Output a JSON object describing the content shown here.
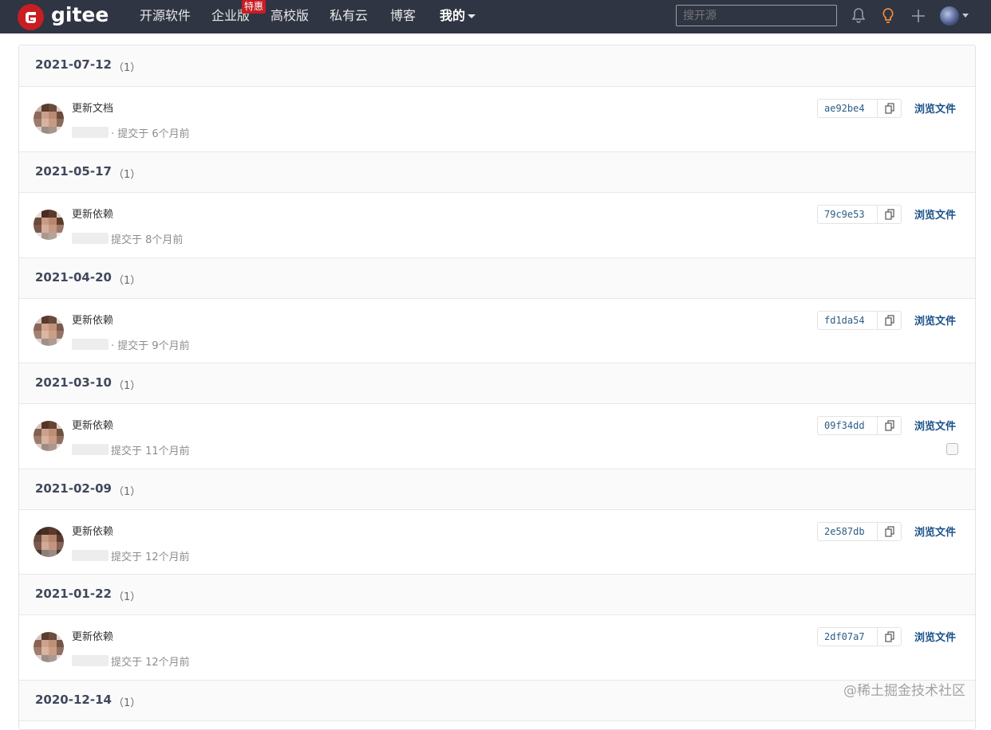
{
  "header": {
    "brand": "gitee",
    "nav": [
      "开源软件",
      "企业版",
      "高校版",
      "私有云",
      "博客",
      "我的"
    ],
    "badge": "特惠",
    "search_placeholder": "搜开源"
  },
  "groups": [
    {
      "date": "2021-07-12",
      "count": "（1）",
      "message": "更新文档",
      "meta": "· 提交于 6个月前",
      "sha": "ae92be4",
      "browse": "浏览文件"
    },
    {
      "date": "2021-05-17",
      "count": "（1）",
      "message": "更新依赖",
      "meta": "提交于 8个月前",
      "sha": "79c9e53",
      "browse": "浏览文件"
    },
    {
      "date": "2021-04-20",
      "count": "（1）",
      "message": "更新依赖",
      "meta": "· 提交于 9个月前",
      "sha": "fd1da54",
      "browse": "浏览文件"
    },
    {
      "date": "2021-03-10",
      "count": "（1）",
      "message": "更新依赖",
      "meta": "提交于 11个月前",
      "sha": "09f34dd",
      "browse": "浏览文件"
    },
    {
      "date": "2021-02-09",
      "count": "（1）",
      "message": "更新依赖",
      "meta": "提交于 12个月前",
      "sha": "2e587db",
      "browse": "浏览文件"
    },
    {
      "date": "2021-01-22",
      "count": "（1）",
      "message": "更新依赖",
      "meta": "提交于 12个月前",
      "sha": "2df07a7",
      "browse": "浏览文件"
    },
    {
      "date": "2020-12-14",
      "count": "（1）"
    }
  ],
  "watermark": "@稀土掘金技术社区",
  "colors": {
    "topbar": "#2f3542",
    "brand": "#c71d23",
    "link": "#19518a"
  }
}
